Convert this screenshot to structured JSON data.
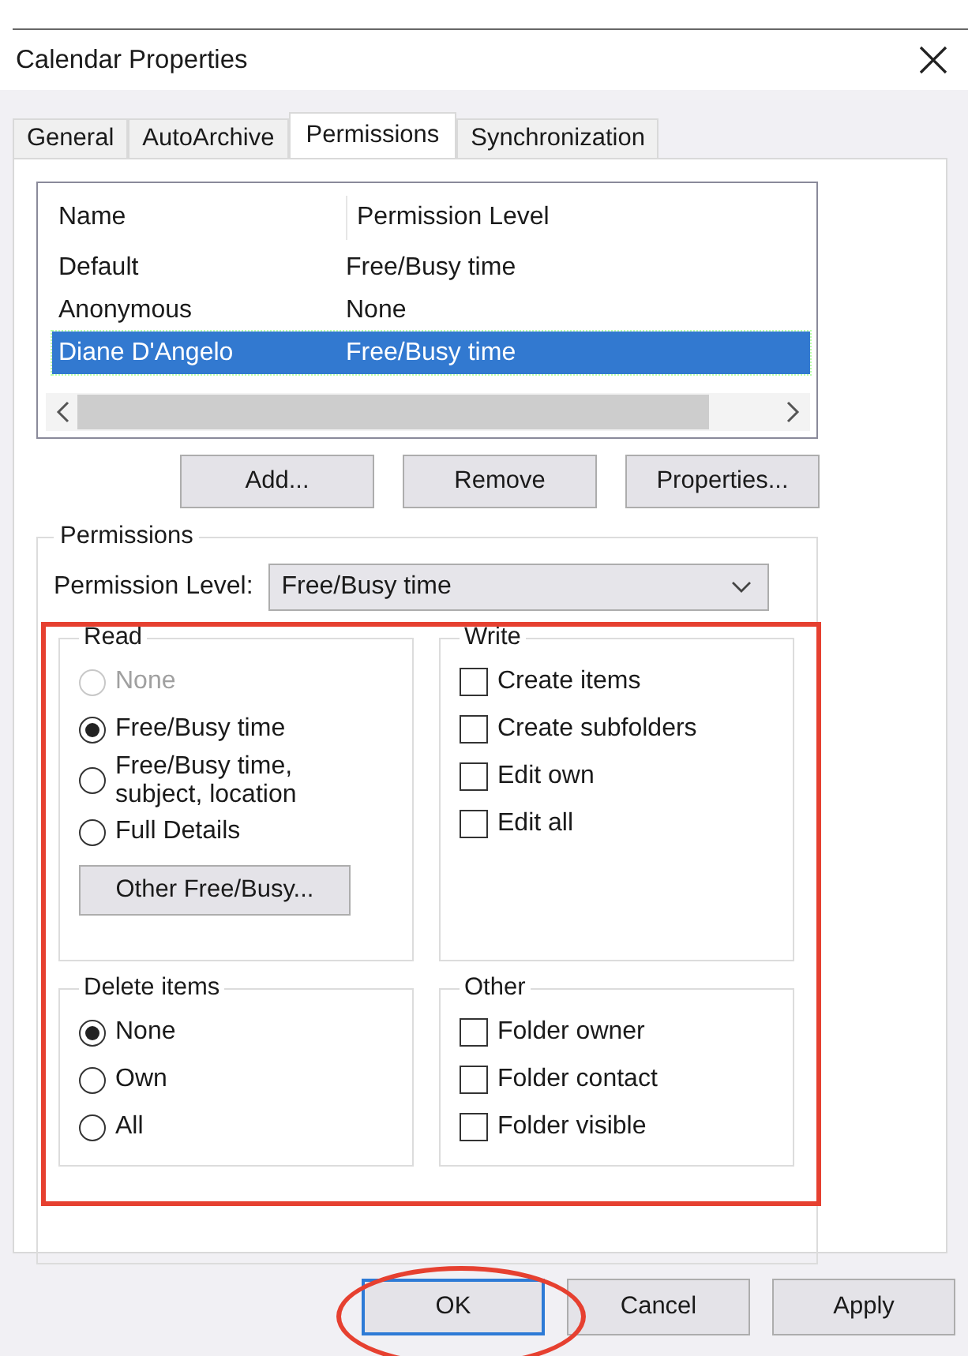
{
  "window": {
    "title": "Calendar Properties"
  },
  "tabs": [
    {
      "label": "General",
      "selected": false
    },
    {
      "label": "AutoArchive",
      "selected": false
    },
    {
      "label": "Permissions",
      "selected": true
    },
    {
      "label": "Synchronization",
      "selected": false
    }
  ],
  "permissions_table": {
    "columns": [
      "Name",
      "Permission Level"
    ],
    "rows": [
      {
        "name": "Default",
        "permission_level": "Free/Busy time",
        "selected": false
      },
      {
        "name": "Anonymous",
        "permission_level": "None",
        "selected": false
      },
      {
        "name": "Diane D'Angelo",
        "permission_level": "Free/Busy time",
        "selected": true
      }
    ]
  },
  "list_buttons": [
    "Add...",
    "Remove",
    "Properties..."
  ],
  "permissions": {
    "title": "Permissions",
    "permission_level_label": "Permission Level:",
    "permission_level_value": "Free/Busy time",
    "read": {
      "title": "Read",
      "options": [
        {
          "label": "None",
          "selected": false,
          "disabled": true
        },
        {
          "label": "Free/Busy time",
          "selected": true,
          "disabled": false
        },
        {
          "label": "Free/Busy time,\nsubject, location",
          "selected": false,
          "disabled": false
        },
        {
          "label": "Full Details",
          "selected": false,
          "disabled": false
        }
      ],
      "button": "Other Free/Busy..."
    },
    "write": {
      "title": "Write",
      "options": [
        {
          "label": "Create items",
          "checked": false
        },
        {
          "label": "Create subfolders",
          "checked": false
        },
        {
          "label": "Edit own",
          "checked": false
        },
        {
          "label": "Edit all",
          "checked": false
        }
      ]
    },
    "delete_items": {
      "title": "Delete items",
      "options": [
        {
          "label": "None",
          "selected": true
        },
        {
          "label": "Own",
          "selected": false
        },
        {
          "label": "All",
          "selected": false
        }
      ]
    },
    "other": {
      "title": "Other",
      "options": [
        {
          "label": "Folder owner",
          "checked": false
        },
        {
          "label": "Folder contact",
          "checked": false
        },
        {
          "label": "Folder visible",
          "checked": false
        }
      ]
    }
  },
  "buttons": [
    {
      "label": "OK",
      "default": true
    },
    {
      "label": "Cancel",
      "default": false
    },
    {
      "label": "Apply",
      "default": false
    }
  ]
}
